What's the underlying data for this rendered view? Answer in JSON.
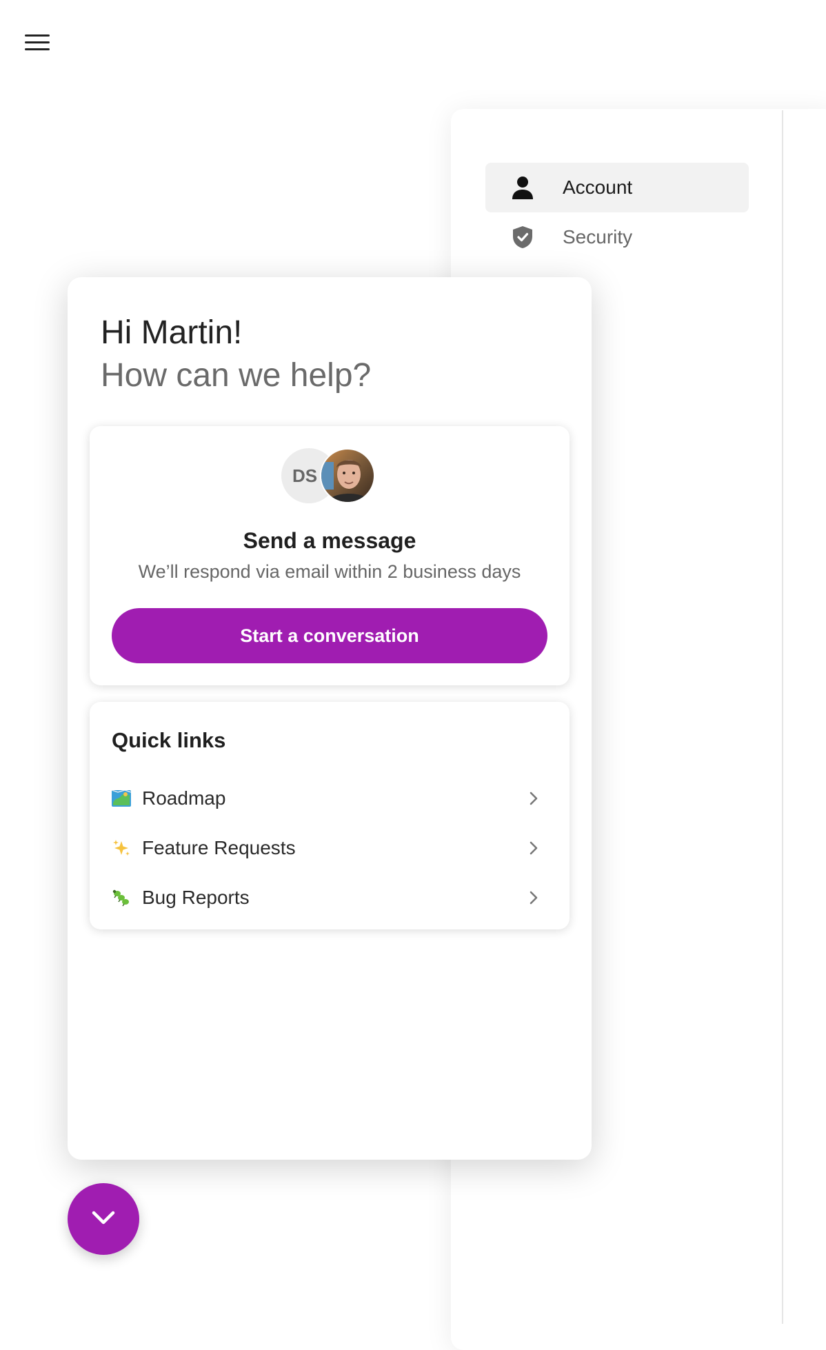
{
  "settings_nav": {
    "items": [
      {
        "label": "Account",
        "icon": "person-icon",
        "active": true
      },
      {
        "label": "Security",
        "icon": "shield-check-icon",
        "active": false
      }
    ]
  },
  "widget": {
    "greeting": "Hi Martin!",
    "subgreeting": "How can we help?",
    "message_card": {
      "avatar_initials": "DS",
      "title": "Send a message",
      "subtitle": "We’ll respond via email within 2 business days",
      "button_label": "Start a conversation"
    },
    "quick_links": {
      "title": "Quick links",
      "items": [
        {
          "label": "Roadmap",
          "icon": "map-icon"
        },
        {
          "label": "Feature Requests",
          "icon": "sparkles-icon"
        },
        {
          "label": "Bug Reports",
          "icon": "bug-icon"
        }
      ]
    }
  },
  "colors": {
    "accent": "#a01db1",
    "nav_active_bg": "#f2f2f2"
  }
}
